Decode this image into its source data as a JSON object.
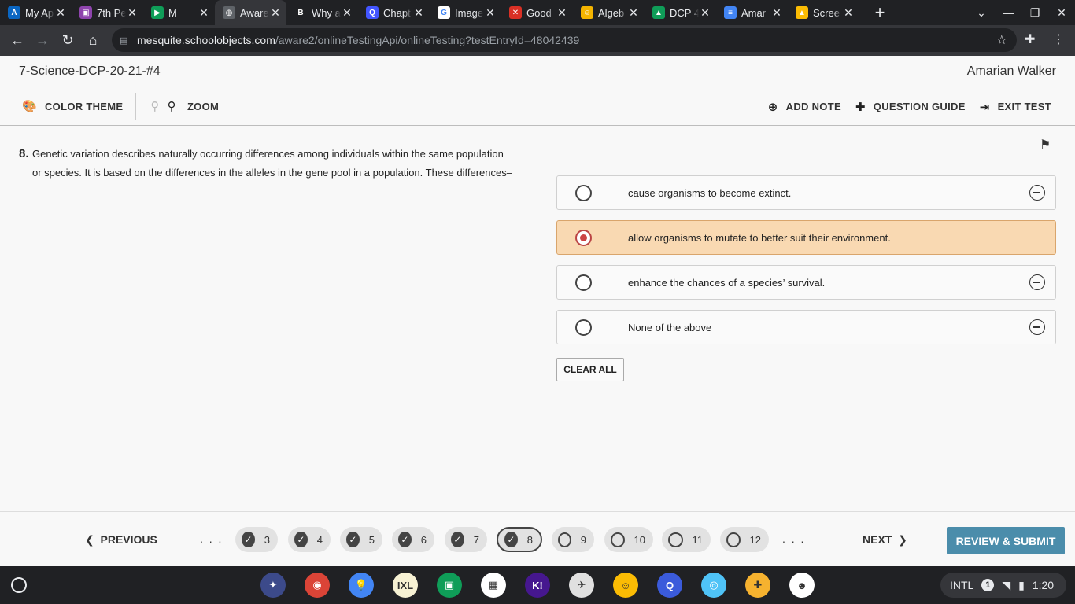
{
  "browser": {
    "tabs": [
      {
        "title": "My Ap",
        "icon": "azure-icon",
        "color": "#0a66c2",
        "glyph": "A"
      },
      {
        "title": "7th Pe",
        "icon": "classroom-icon",
        "color": "#8e44ad",
        "glyph": "▣"
      },
      {
        "title": "M",
        "icon": "meet-icon",
        "color": "#0f9d58",
        "glyph": "▶"
      },
      {
        "title": "Aware",
        "icon": "globe-icon",
        "color": "#5f6368",
        "glyph": "◍"
      },
      {
        "title": "Why a",
        "icon": "brainly-icon",
        "color": "#202124",
        "glyph": "B"
      },
      {
        "title": "Chapt",
        "icon": "quizlet-icon",
        "color": "#4255ff",
        "glyph": "Q"
      },
      {
        "title": "Image",
        "icon": "google-icon",
        "color": "#ffffff",
        "glyph": "G"
      },
      {
        "title": "Good",
        "icon": "x-icon",
        "color": "#d93025",
        "glyph": "✕"
      },
      {
        "title": "Algeb",
        "icon": "emoji-icon",
        "color": "#f4b400",
        "glyph": "☺"
      },
      {
        "title": "DCP 4",
        "icon": "drive-icon",
        "color": "#0f9d58",
        "glyph": "▲"
      },
      {
        "title": "Amar",
        "icon": "docs-icon",
        "color": "#4285f4",
        "glyph": "≡"
      },
      {
        "title": "Scree",
        "icon": "drive-icon",
        "color": "#fbbc04",
        "glyph": "▲"
      }
    ],
    "active_tab": 3,
    "url_host": "mesquite.schoolobjects.com",
    "url_path": "/aware2/onlineTestingApi/onlineTesting?testEntryId=48042439"
  },
  "header": {
    "test_name": "7-Science-DCP-20-21-#4",
    "student": "Amarian Walker"
  },
  "toolbar": {
    "color_theme": "COLOR THEME",
    "zoom": "ZOOM",
    "add_note": "ADD NOTE",
    "question_guide": "QUESTION GUIDE",
    "exit_test": "EXIT TEST"
  },
  "question": {
    "number": "8.",
    "text": "Genetic variation describes naturally occurring differences among individuals within the same population or species.  It is based on the differences in the alleles in the gene pool in a population. These differences–",
    "answers": [
      {
        "text": "cause organisms to become extinct.",
        "selected": false
      },
      {
        "text": "allow organisms to mutate to better suit their environment.",
        "selected": true
      },
      {
        "text": "enhance the chances of a species’ survival.",
        "selected": false
      },
      {
        "text": "None of the above",
        "selected": false
      }
    ],
    "clear_all": "CLEAR ALL"
  },
  "nav": {
    "previous": "PREVIOUS",
    "next": "NEXT",
    "ellipsis": ". . .",
    "questions": [
      {
        "label": "3",
        "answered": true,
        "current": false
      },
      {
        "label": "4",
        "answered": true,
        "current": false
      },
      {
        "label": "5",
        "answered": true,
        "current": false
      },
      {
        "label": "6",
        "answered": true,
        "current": false
      },
      {
        "label": "7",
        "answered": true,
        "current": false
      },
      {
        "label": "8",
        "answered": true,
        "current": true
      },
      {
        "label": "9",
        "answered": false,
        "current": false
      },
      {
        "label": "10",
        "answered": false,
        "current": false
      },
      {
        "label": "11",
        "answered": false,
        "current": false
      },
      {
        "label": "12",
        "answered": false,
        "current": false
      }
    ],
    "review_submit": "REVIEW & SUBMIT"
  },
  "shelf": {
    "apps": [
      {
        "name": "app-1-icon",
        "color": "#3c4a8a",
        "glyph": "✦"
      },
      {
        "name": "chrome-icon",
        "color": "#db4437",
        "glyph": "◉"
      },
      {
        "name": "keep-icon",
        "color": "#4285f4",
        "glyph": "💡"
      },
      {
        "name": "ixl-icon",
        "color": "#f6f1d3",
        "glyph": "IXL"
      },
      {
        "name": "classroom-icon",
        "color": "#0f9d58",
        "glyph": "▣"
      },
      {
        "name": "qr-icon",
        "color": "#ffffff",
        "glyph": "▦"
      },
      {
        "name": "kahoot-icon",
        "color": "#46178f",
        "glyph": "K!"
      },
      {
        "name": "sky-icon",
        "color": "#e0e0e0",
        "glyph": "✈"
      },
      {
        "name": "emoji-icon",
        "color": "#fbbc04",
        "glyph": "☺"
      },
      {
        "name": "quizlet-icon",
        "color": "#3b5bdb",
        "glyph": "Q"
      },
      {
        "name": "camera-icon",
        "color": "#4fc3f7",
        "glyph": "◎"
      },
      {
        "name": "app-puzzle-icon",
        "color": "#f6b22f",
        "glyph": "✚"
      },
      {
        "name": "troll-icon",
        "color": "#ffffff",
        "glyph": "☻"
      }
    ],
    "tray_lang": "INTL",
    "tray_badge": "1",
    "time": "1:20"
  }
}
